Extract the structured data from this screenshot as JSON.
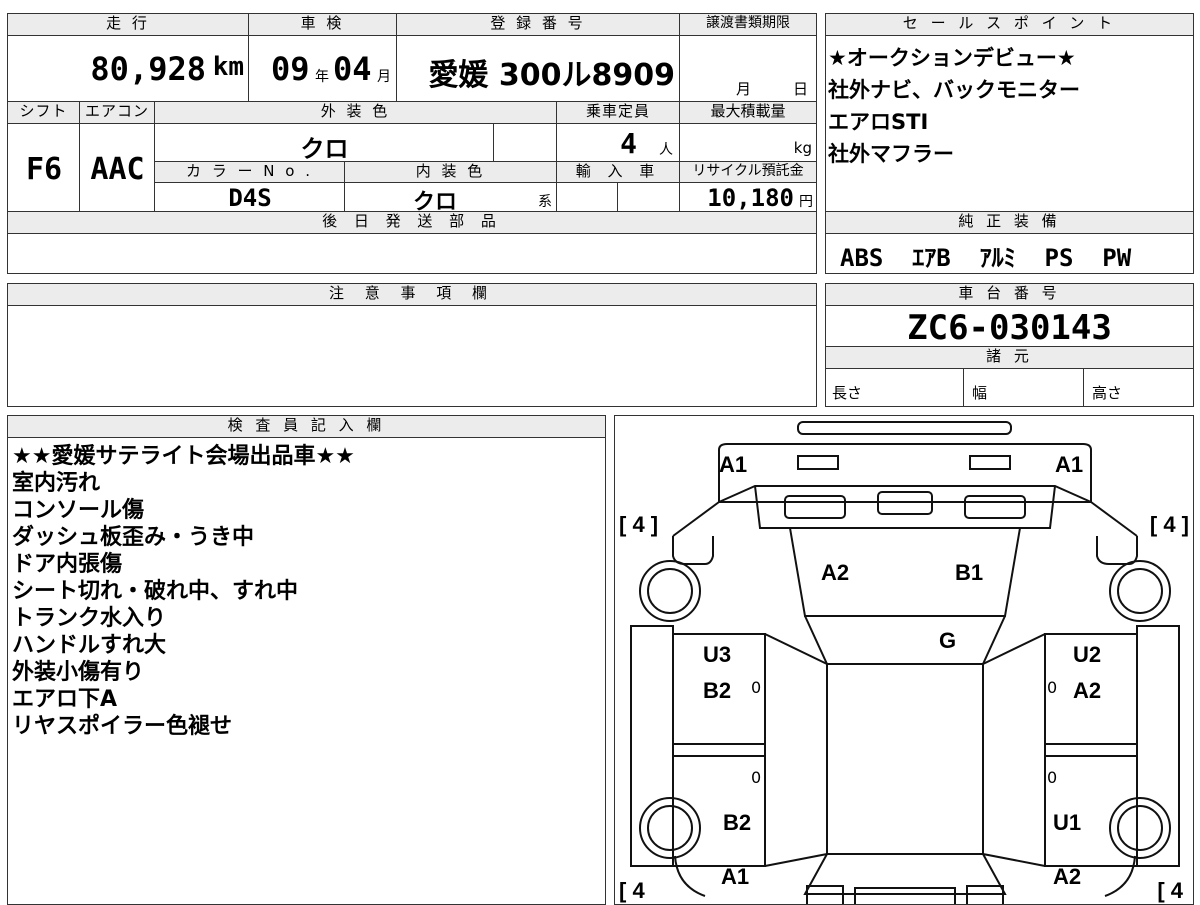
{
  "top": {
    "headers": {
      "mileage": "走 行",
      "inspection": "車 検",
      "registration": "登 録 番 号",
      "transfer_deadline": "譲渡書類期限",
      "shift": "シフト",
      "aircon": "エアコン",
      "exterior_color": "外 装 色",
      "capacity": "乗車定員",
      "max_load": "最大積載量",
      "color_no": "カ ラ ー N o .",
      "interior_color": "内 装 色",
      "import": "輸 入 車",
      "recycle": "リサイクル預託金",
      "later_parts": "後 日 発 送 部 品"
    },
    "mileage_value": "80,928",
    "mileage_unit": "km",
    "inspection_year": "09",
    "year_unit": "年",
    "inspection_month": "04",
    "month_unit": "月",
    "registration_number": "愛媛 300ル8909",
    "deadline_month_unit": "月",
    "deadline_day_unit": "日",
    "shift_value": "F6",
    "aircon_value": "AAC",
    "exterior_color_value": "クロ",
    "capacity_value": "4",
    "capacity_unit": "人",
    "max_load_unit": "kg",
    "color_no_value": "D4S",
    "interior_color_value": "クロ",
    "interior_suffix": "系",
    "recycle_value": "10,180",
    "recycle_unit": "円"
  },
  "sales_points": {
    "header": "セ ー ル ス ポ イ ン ト",
    "lines": [
      "★オークションデビュー★",
      "社外ナビ、バックモニター",
      "エアロSTI",
      "社外マフラー"
    ]
  },
  "genuine_equipment": {
    "header": "純 正 装 備",
    "value": "ABS  ｴｱB  ｱﾙﾐ  PS  PW"
  },
  "notes": {
    "header": "注 意 事 項 欄"
  },
  "chassis": {
    "header": "車 台 番 号",
    "value": "ZC6-030143",
    "specs_header": "諸 元",
    "length_label": "長さ",
    "width_label": "幅",
    "height_label": "高さ"
  },
  "inspector": {
    "header": "検 査 員 記 入 欄",
    "lines": [
      "★★愛媛サテライト会場出品車★★",
      "室内汚れ",
      "コンソール傷",
      "ダッシュ板歪み・うき中",
      "ドア内張傷",
      "シート切れ・破れ中、すれ中",
      "トランク水入り",
      "ハンドルすれ大",
      "外装小傷有り",
      "エアロ下A",
      "リヤスポイラー色褪せ"
    ]
  },
  "diagram": {
    "tire_left_front": "[ 4 ]",
    "tire_right_front": "[ 4 ]",
    "tire_left_rear": "[ 4",
    "tire_right_rear": "[ 4",
    "front_left": "A1",
    "front_right": "A1",
    "hood_left": "A2",
    "hood_right": "B1",
    "windshield": "G",
    "left_front_door_top": "U3",
    "left_front_door_bottom": "B2",
    "right_front_door_top": "U2",
    "right_front_door_bottom": "A2",
    "left_rear_fender": "B2",
    "right_rear_fender": "U1",
    "rear_left": "A1",
    "rear_right": "A2",
    "mark_0": "0"
  }
}
